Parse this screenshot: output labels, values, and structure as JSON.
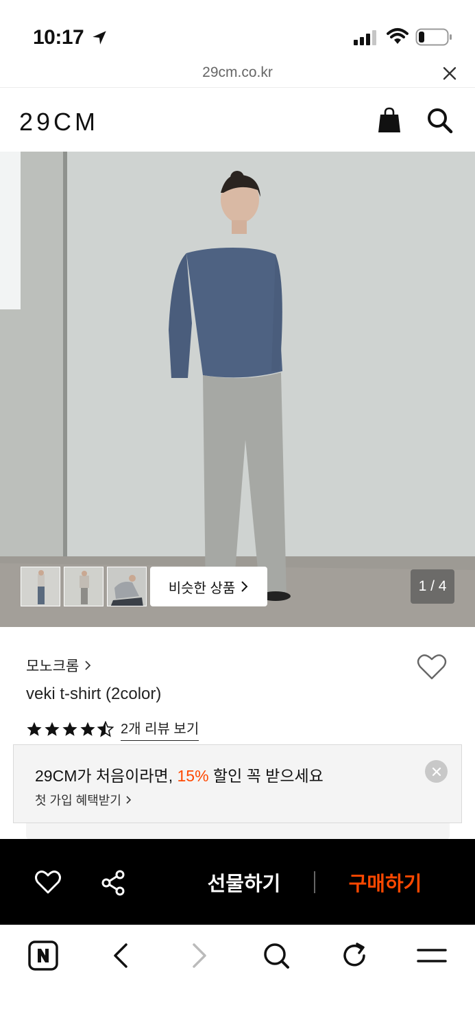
{
  "status": {
    "time": "10:17"
  },
  "browser": {
    "url": "29cm.co.kr"
  },
  "header": {
    "logo": "29CM"
  },
  "gallery": {
    "similar_label": "비슷한 상품",
    "page_indicator": "1 / 4"
  },
  "product": {
    "brand": "모노크롬",
    "name": "veki t-shirt (2color)",
    "rating": 4.5,
    "review_link": "2개 리뷰 보기"
  },
  "promo": {
    "title_before": "29CM가 처음이라면, ",
    "title_accent": "15%",
    "title_after": " 할인 꼭 받으세요",
    "subtitle": "첫 가입 혜택받기"
  },
  "action_bar": {
    "gift_label": "선물하기",
    "purchase_label": "구매하기"
  },
  "colors": {
    "accent": "#ff4800",
    "action_bar_bg": "#000000",
    "promo_bg": "#f4f4f4"
  },
  "icons": {
    "status": [
      "location-arrow-icon",
      "signal-icon",
      "wifi-icon",
      "battery-icon"
    ],
    "header": [
      "shopping-bag-icon",
      "search-icon"
    ],
    "browser_nav": [
      "naver-icon",
      "back-icon",
      "forward-icon",
      "search-icon",
      "reload-icon",
      "menu-icon"
    ]
  }
}
